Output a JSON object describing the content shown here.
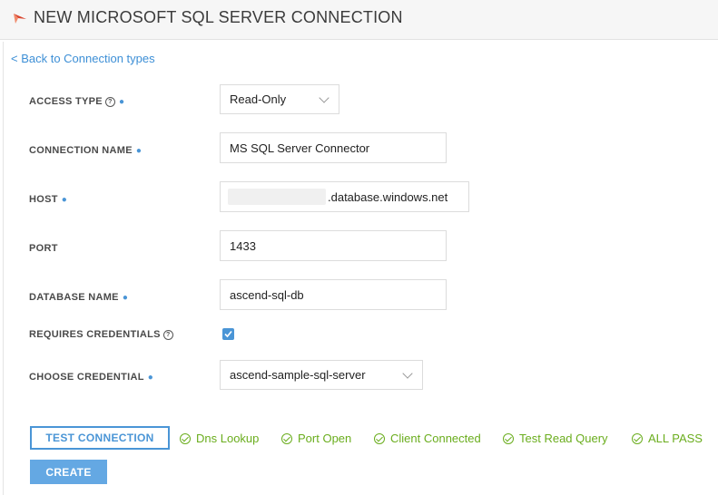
{
  "header": {
    "title": "NEW MICROSOFT SQL SERVER CONNECTION",
    "logo_icon": "ascend-logo-icon"
  },
  "back_link": "< Back to Connection types",
  "form": {
    "access_type": {
      "label": "ACCESS TYPE",
      "value": "Read-Only"
    },
    "connection_name": {
      "label": "CONNECTION NAME",
      "value": "MS SQL Server Connector"
    },
    "host": {
      "label": "HOST",
      "value": ".database.windows.net"
    },
    "port": {
      "label": "PORT",
      "value": "1433"
    },
    "database_name": {
      "label": "DATABASE NAME",
      "value": "ascend-sql-db"
    },
    "requires_credentials": {
      "label": "REQUIRES CREDENTIALS",
      "checked": true
    },
    "choose_credential": {
      "label": "CHOOSE CREDENTIAL",
      "value": "ascend-sample-sql-server"
    }
  },
  "buttons": {
    "test_connection": "TEST CONNECTION",
    "create": "CREATE"
  },
  "statuses": [
    "Dns Lookup",
    "Port Open",
    "Client Connected",
    "Test Read Query",
    "ALL PASS"
  ],
  "colors": {
    "accent": "#4a95d6",
    "success": "#6aad1d"
  }
}
